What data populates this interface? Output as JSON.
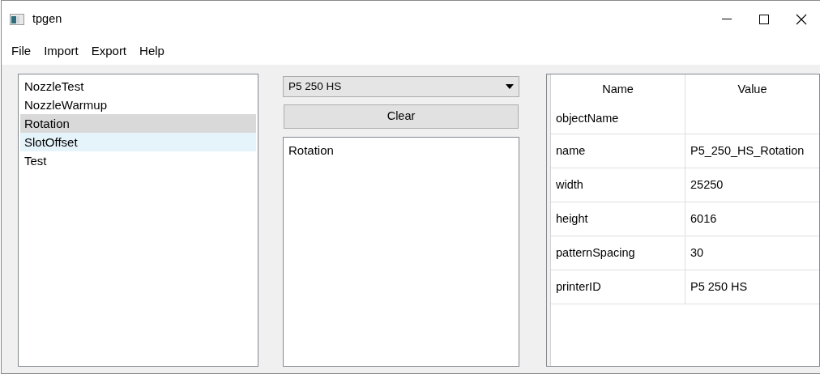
{
  "window": {
    "title": "tpgen"
  },
  "menu": [
    "File",
    "Import",
    "Export",
    "Help"
  ],
  "templates": [
    {
      "label": "NozzleTest",
      "selected": false,
      "hovered": false
    },
    {
      "label": "NozzleWarmup",
      "selected": false,
      "hovered": false
    },
    {
      "label": "Rotation",
      "selected": true,
      "hovered": false
    },
    {
      "label": "SlotOffset",
      "selected": false,
      "hovered": true
    },
    {
      "label": "Test",
      "selected": false,
      "hovered": false
    }
  ],
  "printer_select": {
    "value": "P5 250 HS"
  },
  "clear_button": "Clear",
  "selection_list": [
    "Rotation"
  ],
  "properties": {
    "columns": [
      "Name",
      "Value"
    ],
    "rows": [
      [
        "objectName",
        ""
      ],
      [
        "name",
        "P5_250_HS_Rotation"
      ],
      [
        "width",
        "25250"
      ],
      [
        "height",
        "6016"
      ],
      [
        "patternSpacing",
        "30"
      ],
      [
        "printerID",
        "P5 250 HS"
      ]
    ]
  }
}
